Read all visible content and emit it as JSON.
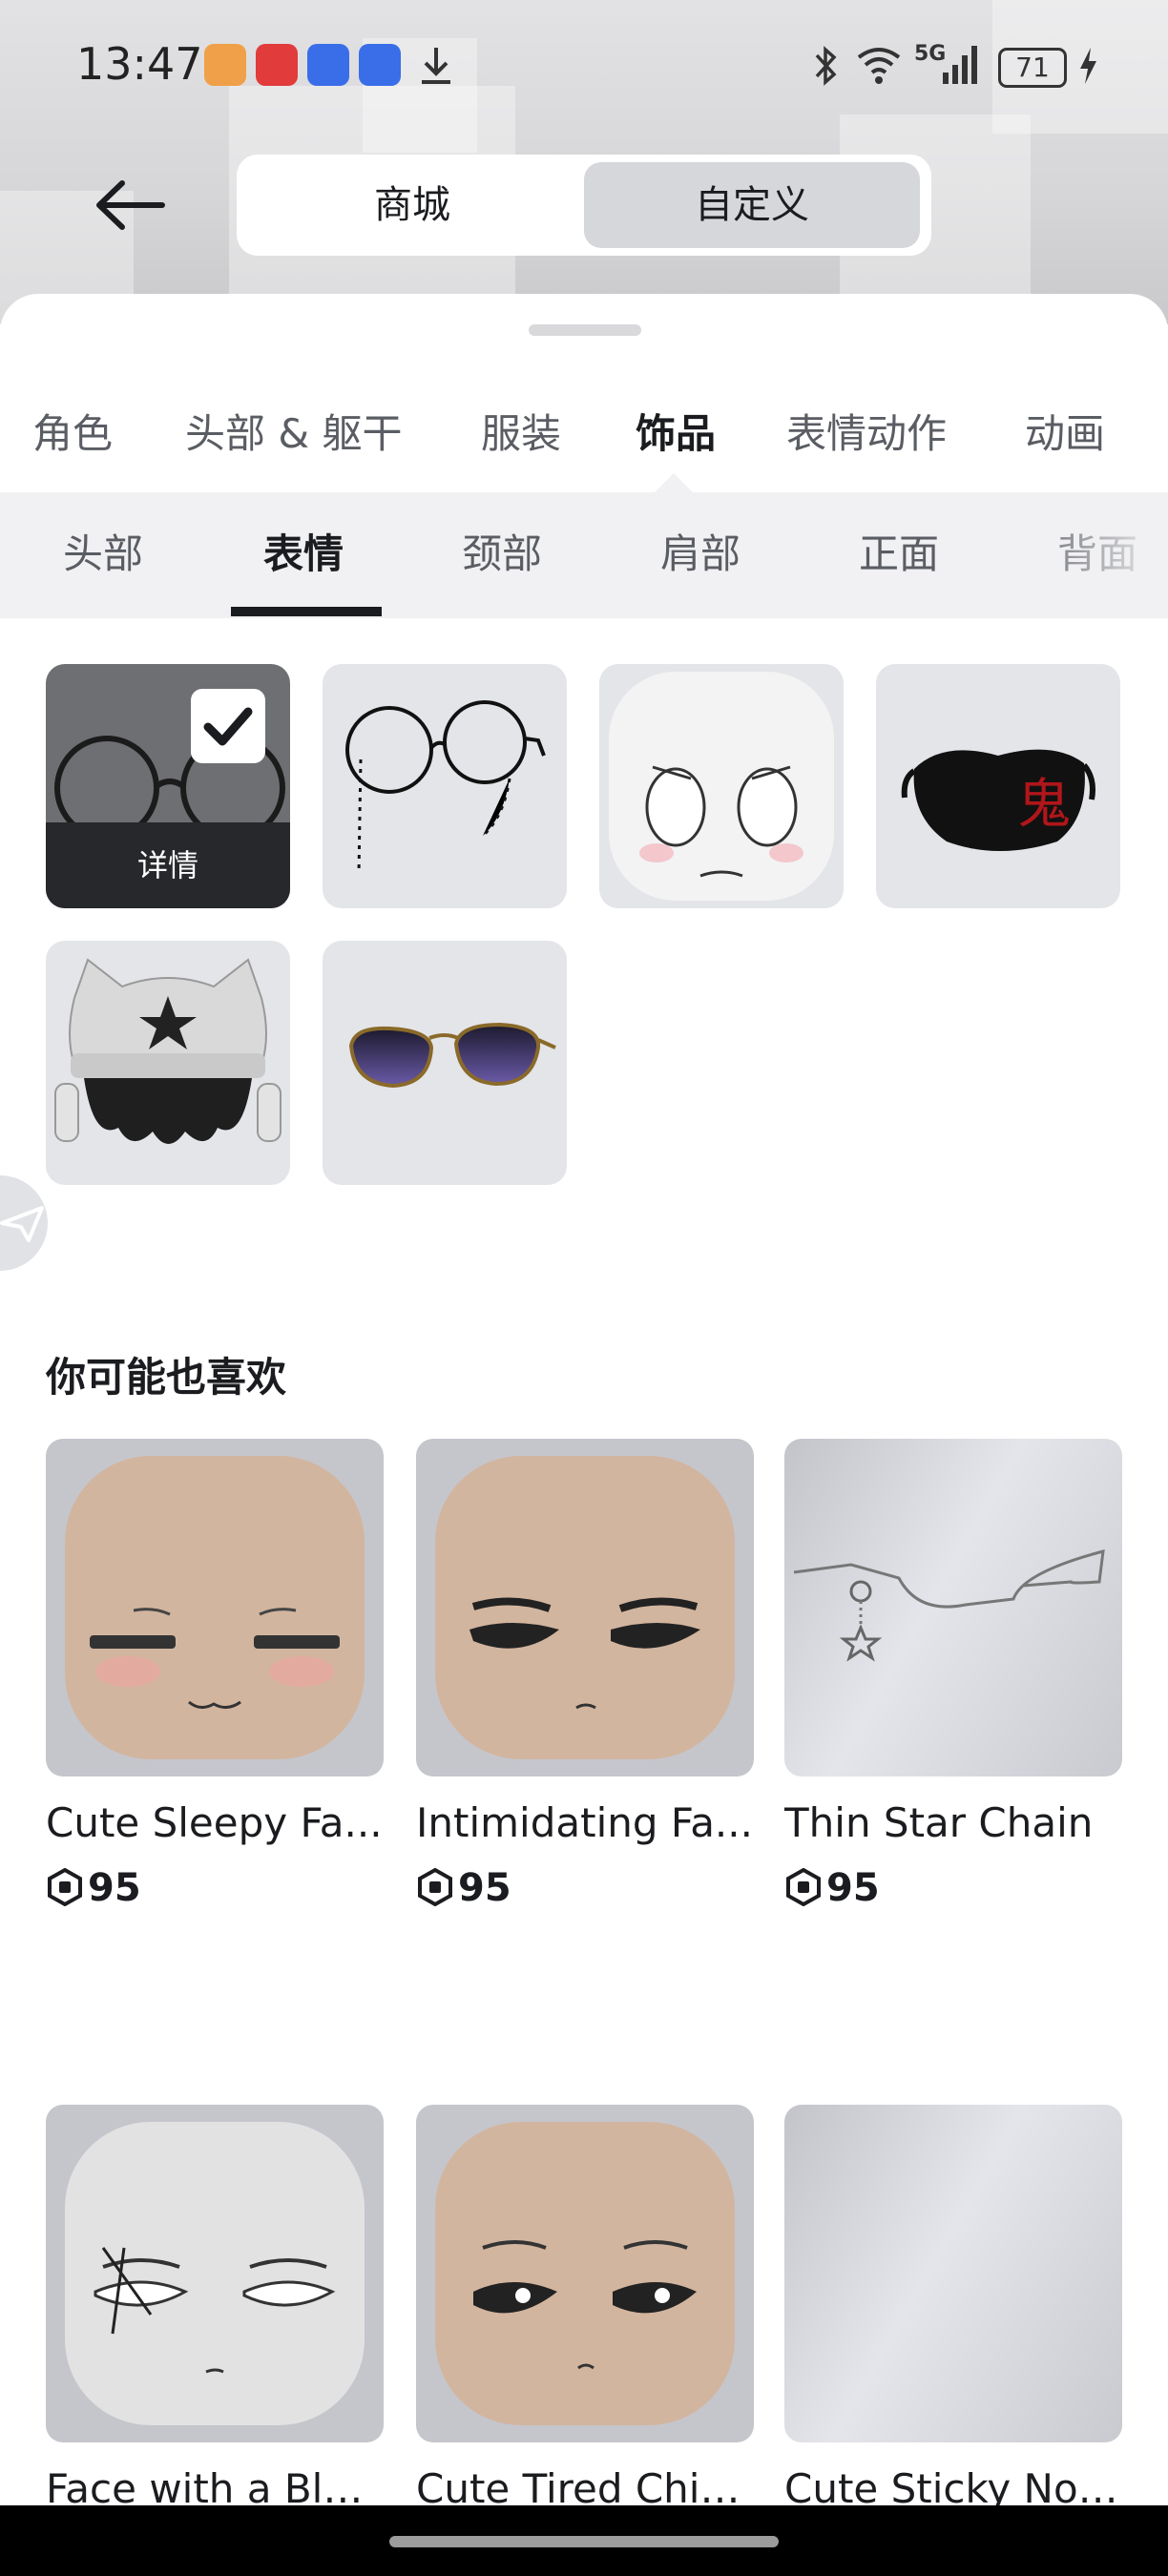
{
  "status_bar": {
    "time": "13:47",
    "network": "5G",
    "battery": "71"
  },
  "top_switch": {
    "back_icon": "arrow-left-icon",
    "tabs": [
      {
        "label": "商城",
        "active": false
      },
      {
        "label": "自定义",
        "active": true
      }
    ]
  },
  "categories": [
    {
      "label": "角色",
      "active": false
    },
    {
      "label": "头部 & 躯干",
      "active": false
    },
    {
      "label": "服装",
      "active": false
    },
    {
      "label": "饰品",
      "active": true
    },
    {
      "label": "表情动作",
      "active": false
    },
    {
      "label": "动画",
      "active": false
    }
  ],
  "subcategories": [
    {
      "label": "头部",
      "active": false
    },
    {
      "label": "表情",
      "active": true
    },
    {
      "label": "颈部",
      "active": false
    },
    {
      "label": "肩部",
      "active": false
    },
    {
      "label": "正面",
      "active": false
    },
    {
      "label": "背面",
      "active": false
    }
  ],
  "owned_items": {
    "selected_detail_label": "详情",
    "items": [
      {
        "icon": "round-glasses-icon",
        "selected": true
      },
      {
        "icon": "chain-glasses-icon",
        "selected": false
      },
      {
        "icon": "crying-face-icon",
        "selected": false
      },
      {
        "icon": "black-mask-icon",
        "selected": false
      },
      {
        "icon": "cat-beanie-hair-icon",
        "selected": false
      },
      {
        "icon": "sunglasses-icon",
        "selected": false
      }
    ],
    "mask_glyph": "鬼"
  },
  "recommendations": {
    "title": "你可能也喜欢",
    "currency_icon": "robux-icon",
    "items": [
      {
        "name": "Cute Sleepy Fa...",
        "price": "95"
      },
      {
        "name": "Intimidating Fa...",
        "price": "95"
      },
      {
        "name": "Thin Star Chain",
        "price": "95"
      },
      {
        "name": "Face with a Bla...",
        "price": ""
      },
      {
        "name": "Cute Tired Chib...",
        "price": ""
      },
      {
        "name": "Cute Sticky Not...",
        "price": ""
      }
    ]
  },
  "colors": {
    "accent": "#1b1c1f",
    "tile_bg": "#e4e5e9",
    "subbar_bg": "#f1f1f3",
    "selected_segment": "#d6d7db"
  }
}
